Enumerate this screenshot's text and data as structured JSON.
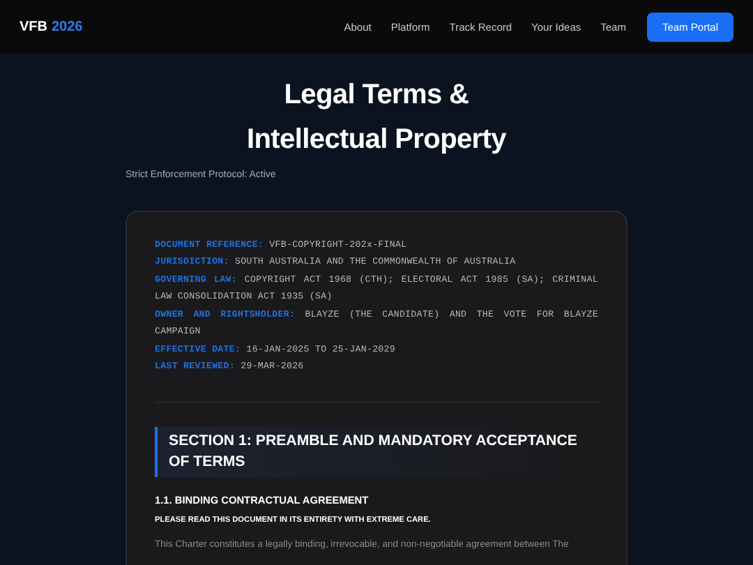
{
  "nav": {
    "logo_main": "VFB",
    "logo_accent": "2026",
    "links": [
      "About",
      "Platform",
      "Track Record",
      "Your Ideas",
      "Team"
    ],
    "button": "Team Portal"
  },
  "hero": {
    "title_lines": [
      "Legal Terms &",
      "Intellectual Property"
    ],
    "subtitle": "Strict Enforcement Protocol: Active"
  },
  "meta": [
    {
      "label": "DOCUMENT REFERENCE:",
      "value": "VFB-COPYRIGHT-202x-FINAL"
    },
    {
      "label": "JURISDICTION:",
      "value": "SOUTH AUSTRALIA AND THE COMMONWEALTH OF AUSTRALIA"
    },
    {
      "label": "GOVERNING LAW:",
      "value": "COPYRIGHT ACT 1968 (CTH); ELECTORAL ACT 1985 (SA); CRIMINAL LAW CONSOLIDATION ACT 1935 (SA)"
    },
    {
      "label": "OWNER AND RIGHTSHOLDER:",
      "value": "BLAYZE (THE CANDIDATE) AND THE VOTE FOR BLAYZE CAMPAIGN"
    },
    {
      "label": "EFFECTIVE DATE:",
      "value": "16-JAN-2025 TO 25-JAN-2029"
    },
    {
      "label": "LAST REVIEWED:",
      "value": "29-MAR-2026"
    }
  ],
  "section": {
    "heading": "SECTION 1: PREAMBLE AND MANDATORY ACCEPTANCE OF TERMS",
    "subheading": "1.1. BINDING CONTRACTUAL AGREEMENT",
    "notice": "PLEASE READ THIS DOCUMENT IN ITS ENTIRETY WITH EXTREME CARE.",
    "paragraph": "This Charter constitutes a legally binding, irrevocable, and non-negotiable agreement between The"
  }
}
